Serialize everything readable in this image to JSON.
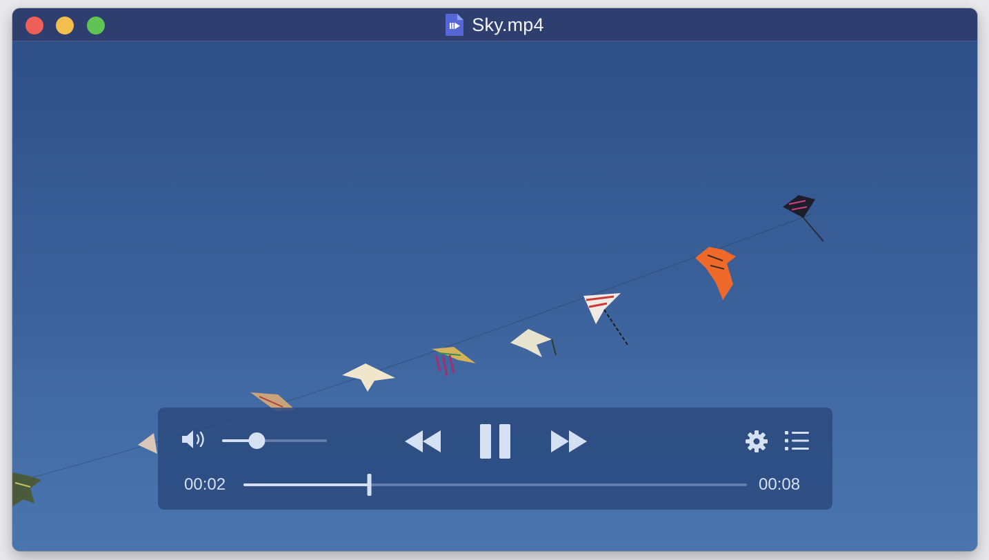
{
  "window": {
    "title": "Sky.mp4",
    "traffic_lights": {
      "close": "#ee5f57",
      "minimize": "#f4be4f",
      "maximize": "#5fc453"
    },
    "file_icon": "video-file-icon"
  },
  "player": {
    "volume_icon": "speaker-icon",
    "volume_level": 0.3,
    "rewind_icon": "rewind-icon",
    "pause_icon": "pause-icon",
    "fast_forward_icon": "fast-forward-icon",
    "settings_icon": "gear-icon",
    "playlist_icon": "list-icon",
    "current_time": "00:02",
    "total_time": "00:08",
    "progress": 0.25
  },
  "colors": {
    "titlebar": "#2d3e6f",
    "sky": "#3c5f98",
    "controls_bg": "#2a487c",
    "controls_fg": "#d6e0f3"
  }
}
